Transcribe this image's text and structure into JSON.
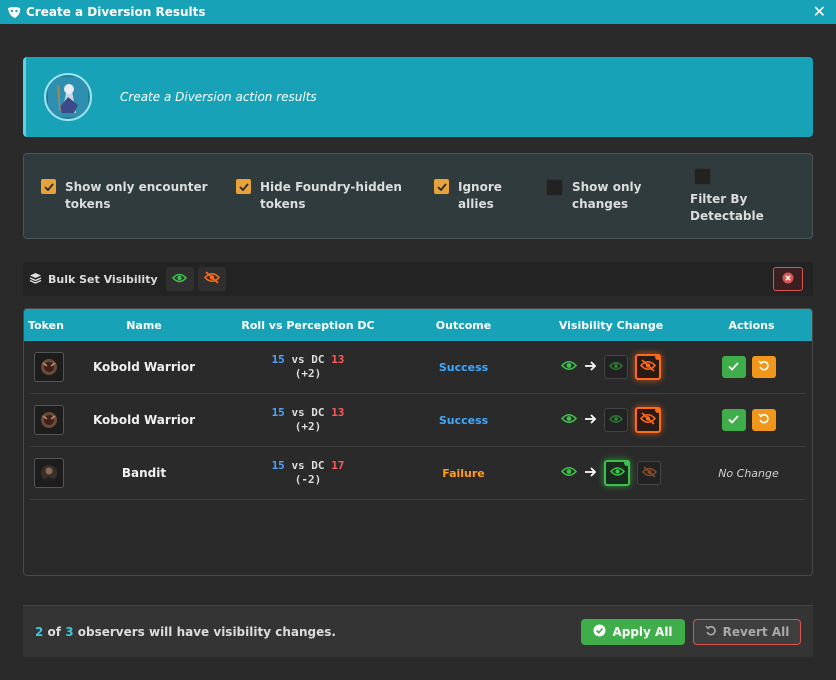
{
  "window": {
    "title": "Create a Diversion Results"
  },
  "header": {
    "subtitle": "Create a Diversion action results"
  },
  "options": [
    {
      "label_line1": "Show only encounter",
      "label_line2": "tokens",
      "checked": true
    },
    {
      "label_line1": "Hide Foundry-hidden",
      "label_line2": "tokens",
      "checked": true
    },
    {
      "label_line1": "Ignore",
      "label_line2": "allies",
      "checked": true
    },
    {
      "label_line1": "Show only",
      "label_line2": "changes",
      "checked": false
    },
    {
      "label_line1": "Filter By",
      "label_line2": "Detectable",
      "checked": false
    }
  ],
  "bulk": {
    "label": "Bulk Set Visibility"
  },
  "table": {
    "columns": [
      "Token",
      "Name",
      "Roll vs Perception DC",
      "Outcome",
      "Visibility Change",
      "Actions"
    ],
    "rows": [
      {
        "name": "Kobold Warrior",
        "roll": "15",
        "vs": "vs DC",
        "dc": "13",
        "mod": "(+2)",
        "outcome": "Success",
        "outcome_type": "success",
        "action": "buttons"
      },
      {
        "name": "Kobold Warrior",
        "roll": "15",
        "vs": "vs DC",
        "dc": "13",
        "mod": "(+2)",
        "outcome": "Success",
        "outcome_type": "success",
        "action": "buttons"
      },
      {
        "name": "Bandit",
        "roll": "15",
        "vs": "vs DC",
        "dc": "17",
        "mod": "(-2)",
        "outcome": "Failure",
        "outcome_type": "failure",
        "action": "No Change"
      }
    ]
  },
  "footer": {
    "count": "2",
    "of": "of",
    "total": "3",
    "text": "observers will have visibility changes.",
    "apply_label": "Apply All",
    "revert_label": "Revert All"
  },
  "colors": {
    "accent": "#17a2b8",
    "success": "#3fae4a",
    "warning": "#f0961a",
    "danger": "#d9534f"
  }
}
